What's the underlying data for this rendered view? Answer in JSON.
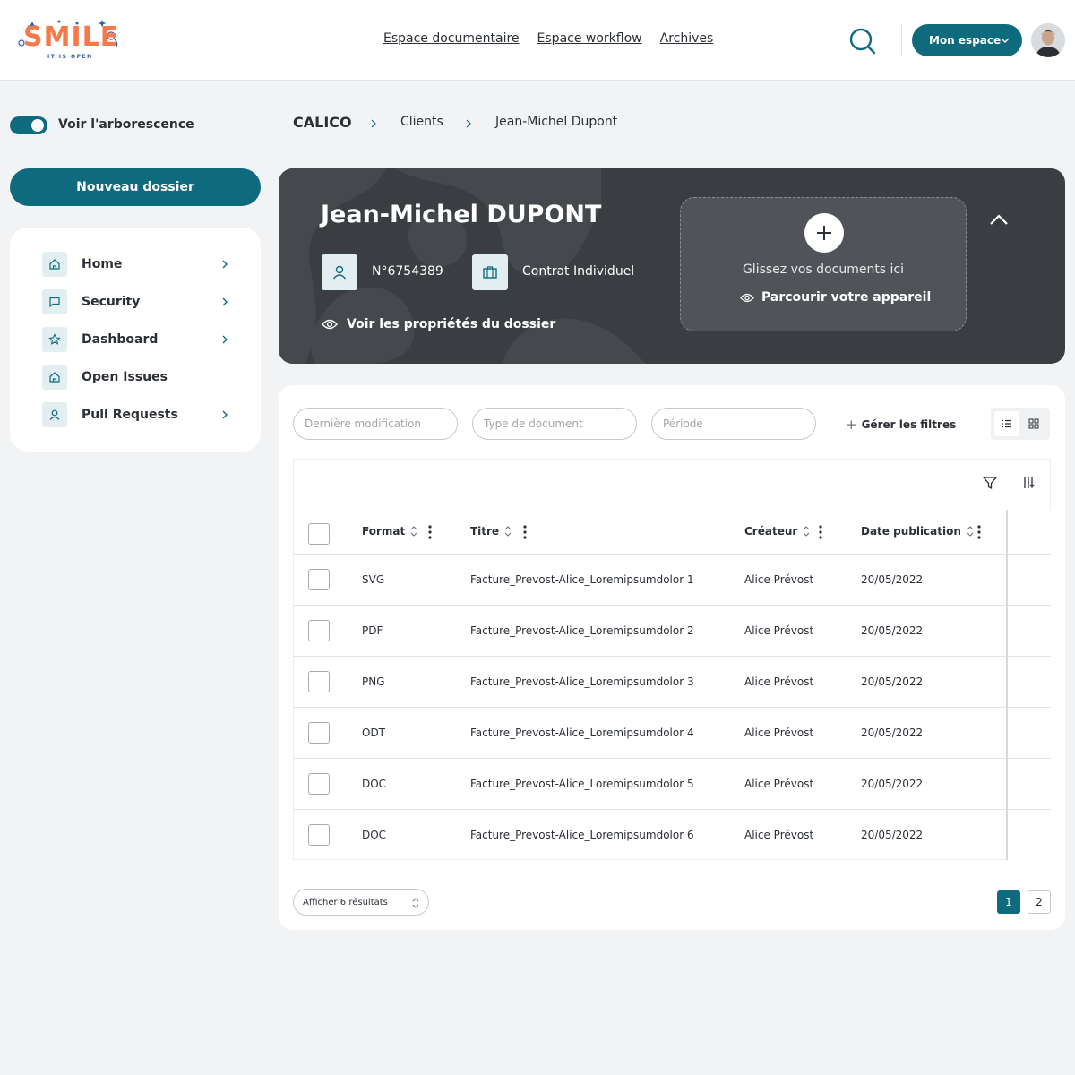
{
  "header": {
    "logo_text": "SMILE",
    "logo_tagline": "IT IS OPEN",
    "nav": [
      "Espace documentaire",
      "Espace workflow",
      "Archives"
    ],
    "account_button": "Mon espace"
  },
  "sidebar": {
    "tree_toggle_label": "Voir l'arborescence",
    "tree_toggle_on": true,
    "new_folder_button": "Nouveau dossier",
    "items": [
      {
        "label": "Home",
        "icon": "home-icon",
        "has_chevron": true
      },
      {
        "label": "Security",
        "icon": "message-icon",
        "has_chevron": true
      },
      {
        "label": "Dashboard",
        "icon": "star-icon",
        "has_chevron": true
      },
      {
        "label": "Open Issues",
        "icon": "home-icon",
        "has_chevron": false
      },
      {
        "label": "Pull Requests",
        "icon": "user-icon",
        "has_chevron": true
      }
    ]
  },
  "breadcrumb": [
    "CALICO",
    "Clients",
    "Jean-Michel Dupont"
  ],
  "folder": {
    "title": "Jean-Michel DUPONT",
    "client_number": "N°6754389",
    "contract_type": "Contrat Individuel",
    "properties_link": "Voir les propriétés du dossier",
    "dropzone_text": "Glissez vos documents ici",
    "browse_link": "Parcourir votre appareil"
  },
  "filters": {
    "placeholders": [
      "Dernière modification",
      "Type de document",
      "Période"
    ],
    "manage_label": "Gérer les filtres",
    "view_mode": "list"
  },
  "table": {
    "columns": [
      "Format",
      "Titre",
      "Créateur",
      "Date publication"
    ],
    "rows": [
      {
        "format": "SVG",
        "title": "Facture_Prevost-Alice_Loremipsumdolor 1",
        "creator": "Alice Prévost",
        "date": "20/05/2022"
      },
      {
        "format": "PDF",
        "title": "Facture_Prevost-Alice_Loremipsumdolor 2",
        "creator": "Alice Prévost",
        "date": "20/05/2022"
      },
      {
        "format": "PNG",
        "title": "Facture_Prevost-Alice_Loremipsumdolor 3",
        "creator": "Alice Prévost",
        "date": "20/05/2022"
      },
      {
        "format": "ODT",
        "title": "Facture_Prevost-Alice_Loremipsumdolor 4",
        "creator": "Alice Prévost",
        "date": "20/05/2022"
      },
      {
        "format": "DOC",
        "title": "Facture_Prevost-Alice_Loremipsumdolor 5",
        "creator": "Alice Prévost",
        "date": "20/05/2022"
      },
      {
        "format": "DOC",
        "title": "Facture_Prevost-Alice_Loremipsumdolor 6",
        "creator": "Alice Prévost",
        "date": "20/05/2022"
      }
    ]
  },
  "pagination": {
    "page_size_label": "Afficher 6 résultats",
    "pages": [
      "1",
      "2"
    ],
    "current_page": "1"
  },
  "colors": {
    "primary": "#0e6b7e",
    "hero_bg": "#3a3d42",
    "page_bg": "#f2f3f4",
    "logo_orange": "#f47a4c"
  }
}
